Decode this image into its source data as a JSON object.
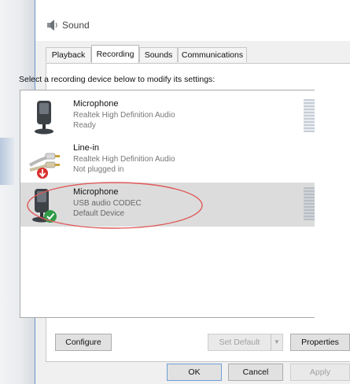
{
  "window": {
    "title": "Sound"
  },
  "tabs": [
    {
      "label": "Playback",
      "active": false
    },
    {
      "label": "Recording",
      "active": true
    },
    {
      "label": "Sounds",
      "active": false
    },
    {
      "label": "Communications",
      "active": false
    }
  ],
  "instruction": "Select a recording device below to modify its settings:",
  "devices": [
    {
      "name": "Microphone",
      "driver": "Realtek High Definition Audio",
      "status": "Ready",
      "icon": "microphone-icon",
      "selected": false
    },
    {
      "name": "Line-in",
      "driver": "Realtek High Definition Audio",
      "status": "Not plugged in",
      "icon": "line-in-cable-icon",
      "badge": "red-down-arrow-badge",
      "selected": false
    },
    {
      "name": "Microphone",
      "driver": "USB audio CODEC",
      "status": "Default Device",
      "icon": "microphone-icon",
      "badge": "green-check-badge",
      "selected": true
    }
  ],
  "buttons": {
    "configure": "Configure",
    "set_default": "Set Default",
    "set_default_dropdown": "▼",
    "properties": "Properties",
    "ok": "OK",
    "cancel": "Cancel",
    "apply": "Apply"
  },
  "colors": {
    "selected_row": "#dcdcdc",
    "annotation_ellipse": "#e05a5a",
    "badge_green": "#2e9c47",
    "badge_red": "#d8322c",
    "window_accent": "#6c97c9"
  }
}
